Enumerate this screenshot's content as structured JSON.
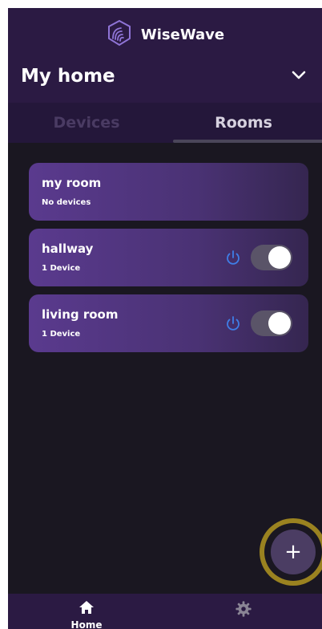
{
  "app": {
    "name": "WiseWave"
  },
  "header": {
    "home_title": "My home"
  },
  "tabs": [
    {
      "label": "Devices",
      "active": false
    },
    {
      "label": "Rooms",
      "active": true
    }
  ],
  "rooms": [
    {
      "name": "my room",
      "subtitle": "No devices",
      "has_controls": false
    },
    {
      "name": "hallway",
      "subtitle": "1 Device",
      "has_controls": true,
      "on": true
    },
    {
      "name": "living room",
      "subtitle": "1 Device",
      "has_controls": true,
      "on": true
    }
  ],
  "fab": {
    "icon": "plus-icon",
    "symbol": "+"
  },
  "bottom_nav": [
    {
      "label": "Home",
      "icon": "home-icon",
      "active": true
    },
    {
      "label": "",
      "icon": "gear-icon",
      "active": false
    }
  ],
  "colors": {
    "background": "#1a1721",
    "header": "#2b1a43",
    "accent_blue": "#3f7ee8",
    "room_gradient_start": "#5a3a8e",
    "fab_ring": "#9a8220"
  }
}
